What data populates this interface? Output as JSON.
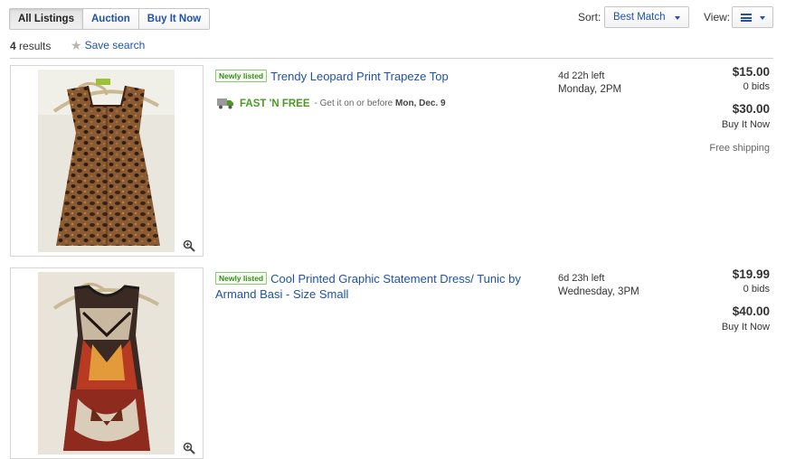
{
  "tabs": [
    {
      "label": "All Listings",
      "active": true
    },
    {
      "label": "Auction",
      "active": false
    },
    {
      "label": "Buy It Now",
      "active": false
    }
  ],
  "sort": {
    "label": "Sort:",
    "value": "Best Match"
  },
  "view": {
    "label": "View:",
    "icon": "list-view-icon"
  },
  "results": {
    "count": "4",
    "suffix": "results"
  },
  "save_search": {
    "label": "Save search",
    "icon": "star-icon"
  },
  "items": [
    {
      "badge": "Newly listed",
      "title": "Trendy Leopard Print Trapeze Top",
      "shipping_fast": "FAST 'N FREE",
      "shipping_text": "- Get it on or before",
      "shipping_date": "Mon, Dec. 9",
      "time_left": "4d 22h left",
      "end_time": "Monday, 2PM",
      "bid_price": "$15.00",
      "bids": "0 bids",
      "bin_price": "$30.00",
      "bin_label": "Buy It Now",
      "free_shipping": "Free shipping"
    },
    {
      "badge": "Newly listed",
      "title": "Cool Printed Graphic Statement Dress/ Tunic by Armand Basi - Size Small",
      "time_left": "6d 23h left",
      "end_time": "Wednesday, 3PM",
      "bid_price": "$19.99",
      "bids": "0 bids",
      "bin_price": "$40.00",
      "bin_label": "Buy It Now"
    }
  ],
  "colors": {
    "link": "#1f52a6",
    "green": "#4b9a22",
    "text": "#333333"
  }
}
